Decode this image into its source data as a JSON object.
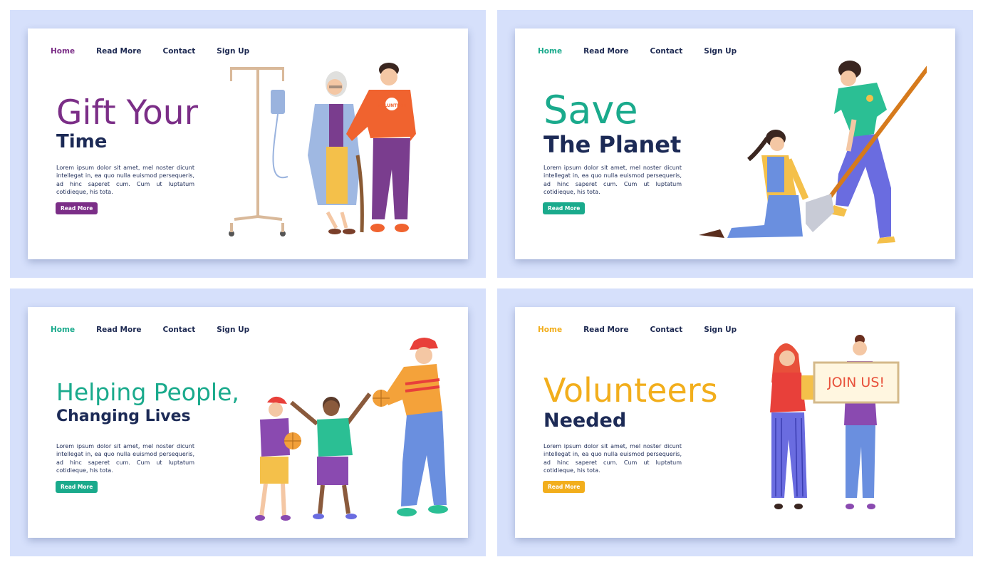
{
  "screens": [
    {
      "nav": [
        "Home",
        "Read More",
        "Contact",
        "Sign Up"
      ],
      "title": "Gift Your",
      "subtitle": "Time",
      "body": "Lorem ipsum dolor sit amet, mel noster dicunt intellegat in, ea quo nulla euismod persequeris, ad hinc saperet cum. Cum ut luptatum cotidieque, his tota.",
      "button": "Read More",
      "accent": "#7b2e87",
      "illustration_text": "VOLUNTEER"
    },
    {
      "nav": [
        "Home",
        "Read More",
        "Contact",
        "Sign Up"
      ],
      "title": "Save",
      "subtitle": "The Planet",
      "body": "Lorem ipsum dolor sit amet, mel noster dicunt intellegat in, ea quo nulla euismod persequeris, ad hinc saperet cum. Cum ut luptatum cotidieque, his tota.",
      "button": "Read More",
      "accent": "#1aaa8c"
    },
    {
      "nav": [
        "Home",
        "Read More",
        "Contact",
        "Sign Up"
      ],
      "title": "Helping People,",
      "subtitle": "Changing Lives",
      "body": "Lorem ipsum dolor sit amet, mel noster dicunt intellegat in, ea quo nulla euismod persequeris, ad hinc saperet cum. Cum ut luptatum cotidieque, his tota.",
      "button": "Read More",
      "accent": "#1aaa8c"
    },
    {
      "nav": [
        "Home",
        "Read More",
        "Contact",
        "Sign Up"
      ],
      "title": "Volunteers",
      "subtitle": "Needed",
      "body": "Lorem ipsum dolor sit amet, mel noster dicunt intellegat in, ea quo nulla euismod persequeris, ad hinc saperet cum. Cum ut luptatum cotidieque, his tota.",
      "button": "Read More",
      "accent": "#f2ae1c",
      "illustration_text": "JOIN US!"
    }
  ]
}
